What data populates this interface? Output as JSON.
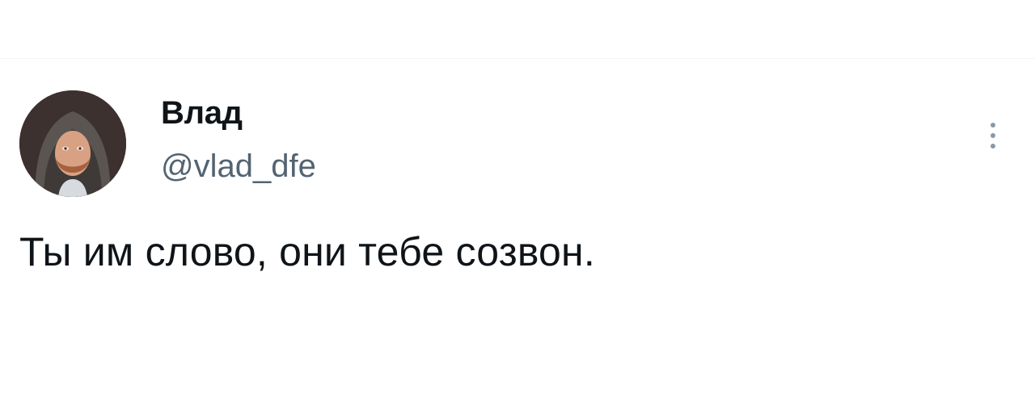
{
  "tweet": {
    "author": {
      "display_name": "Влад",
      "handle": "@vlad_dfe",
      "avatar_icon": "user-avatar-photo"
    },
    "text": "Ты им слово, они тебе созвон.",
    "more_icon": "more-vertical-icon"
  },
  "colors": {
    "background": "#ffffff",
    "text_primary": "#0f1419",
    "text_secondary": "#536471"
  }
}
